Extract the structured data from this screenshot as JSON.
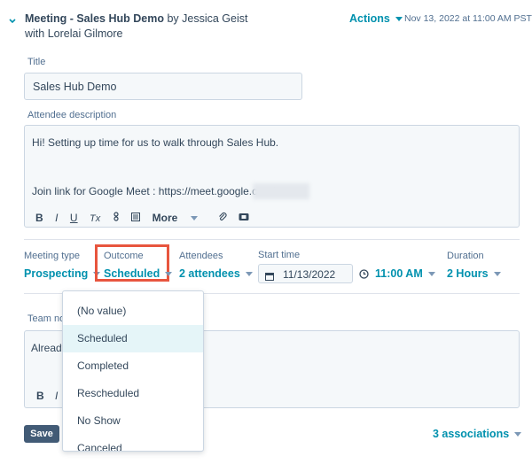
{
  "header": {
    "title": "Meeting - Sales Hub Demo",
    "by_prefix": "by",
    "owner": "Jessica Geist",
    "with_line": "with Lorelai Gilmore",
    "actions_label": "Actions",
    "timestamp": "Nov 13, 2022 at 11:00 AM PST"
  },
  "title_field": {
    "label": "Title",
    "value": "Sales Hub Demo"
  },
  "attendee_description": {
    "label": "Attendee description",
    "line1": "Hi! Setting up time for us to walk through Sales Hub.",
    "line2": "Join link for Google Meet : https://meet.google.com/",
    "toolbar": {
      "bold": "B",
      "italic": "I",
      "underline": "U",
      "clear_format": "Tx",
      "more_label": "More"
    }
  },
  "meeting_fields": {
    "meeting_type": {
      "label": "Meeting type",
      "value": "Prospecting"
    },
    "outcome": {
      "label": "Outcome",
      "value": "Scheduled"
    },
    "attendees": {
      "label": "Attendees",
      "value": "2 attendees"
    },
    "start_time": {
      "label": "Start time",
      "date": "11/13/2022",
      "time": "11:00 AM"
    },
    "duration": {
      "label": "Duration",
      "value": "2 Hours"
    }
  },
  "team_notes": {
    "label_partial": "Team not",
    "text_partial": "Already",
    "toolbar": {
      "bold": "B",
      "italic": "I"
    }
  },
  "outcome_dropdown": {
    "options": [
      "(No value)",
      "Scheduled",
      "Completed",
      "Rescheduled",
      "No Show",
      "Canceled"
    ],
    "selected": "Scheduled"
  },
  "footer": {
    "save_label": "Save",
    "associations_label": "3 associations"
  },
  "colors": {
    "accent": "#0091ae",
    "highlight_box": "#e8553e",
    "save_button": "#425b76"
  }
}
